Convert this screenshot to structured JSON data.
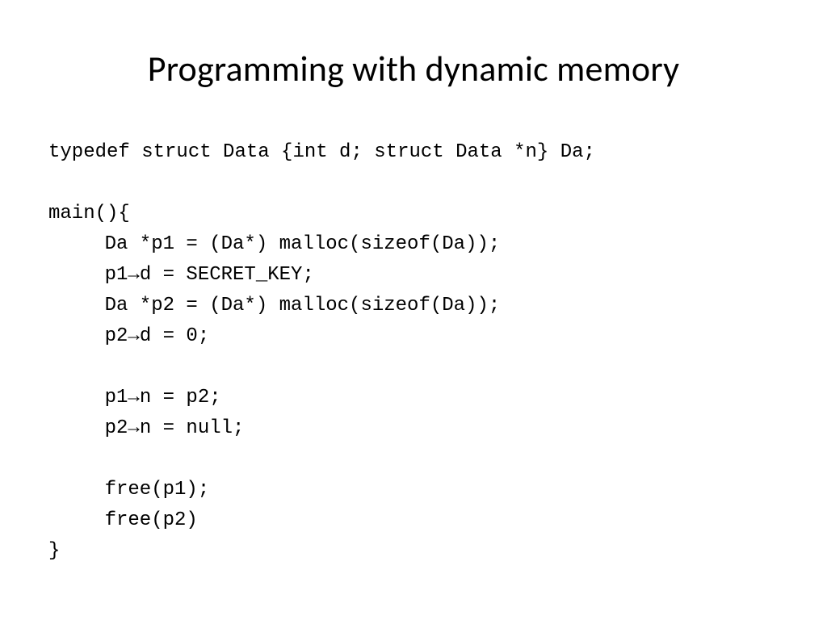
{
  "title": "Programming with dynamic memory",
  "code": {
    "line1": "typedef struct Data {int d; struct Data *n} Da;",
    "line2": "main(){",
    "line3a": "Da *p1 = (Da*) malloc(sizeof(Da));",
    "line4a": "p1",
    "line4b": "d = SECRET_KEY;",
    "line5a": "Da *p2 = (Da*) malloc(sizeof(Da));",
    "line6a": "p2",
    "line6b": "d = 0;",
    "line7a": "p1",
    "line7b": "n = p2;",
    "line8a": "p2",
    "line8b": "n = null;",
    "line9": "free(p1);",
    "line10": "free(p2)",
    "line11": "}",
    "arrow": "→"
  }
}
